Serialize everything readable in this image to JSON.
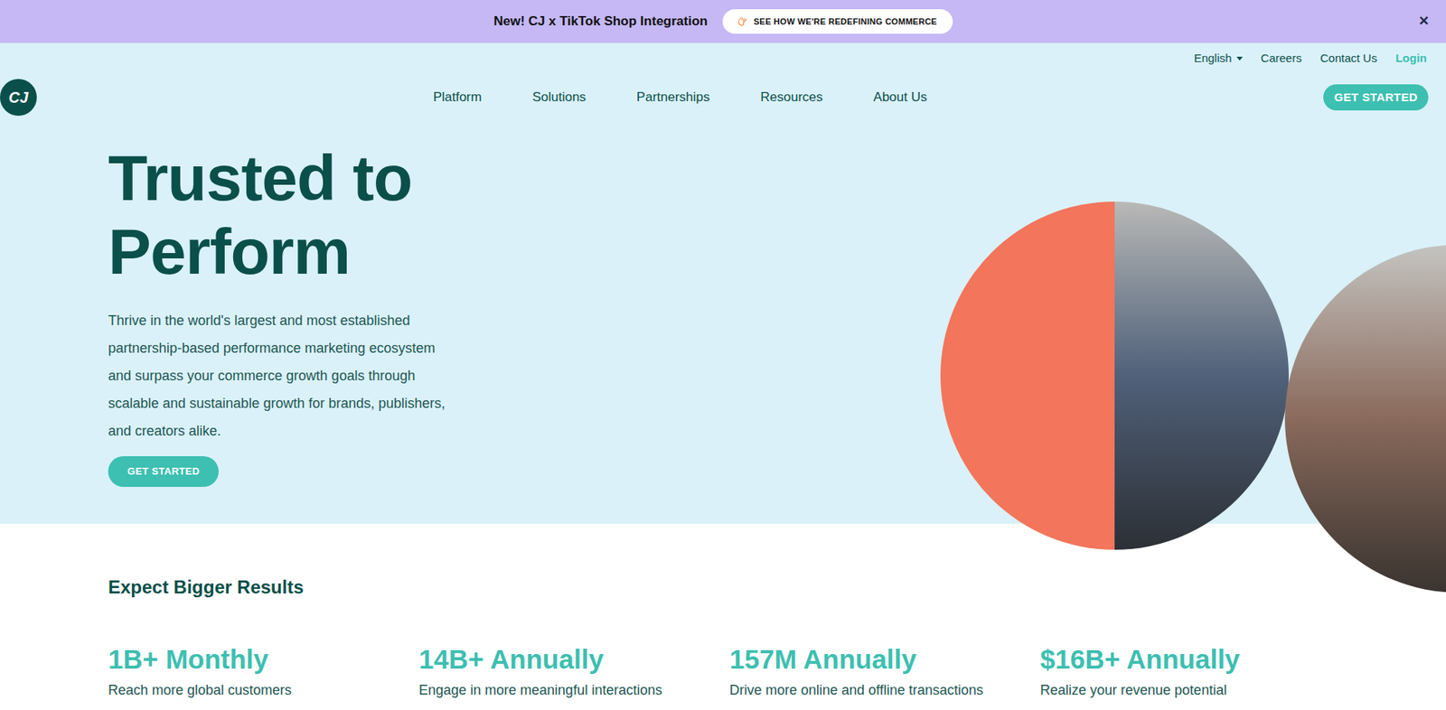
{
  "banner": {
    "text": "New! CJ x TikTok Shop Integration",
    "button": "SEE HOW WE'RE REDEFINING COMMERCE",
    "close": "✕"
  },
  "utility_nav": {
    "language": "English",
    "links": [
      "Careers",
      "Contact Us"
    ],
    "login": "Login"
  },
  "logo": {
    "text": "CJ"
  },
  "nav": {
    "items": [
      "Platform",
      "Solutions",
      "Partnerships",
      "Resources",
      "About Us"
    ],
    "cta": "GET STARTED"
  },
  "hero": {
    "title_lines": [
      "Trusted to",
      "Perform"
    ],
    "body": "Thrive in the world's largest and most established partnership-based performance marketing ecosystem and surpass your commerce growth goals through scalable and sustainable growth for brands, publishers, and creators alike.",
    "cta": "GET STARTED"
  },
  "results": {
    "title": "Expect Bigger Results",
    "stats": [
      {
        "value": "1B+ Monthly",
        "label": "Reach more global customers"
      },
      {
        "value": "14B+ Annually",
        "label": "Engage in more meaningful interactions"
      },
      {
        "value": "157M Annually",
        "label": "Drive more online and offline transactions"
      },
      {
        "value": "$16B+ Annually",
        "label": "Realize your revenue potential"
      }
    ]
  }
}
